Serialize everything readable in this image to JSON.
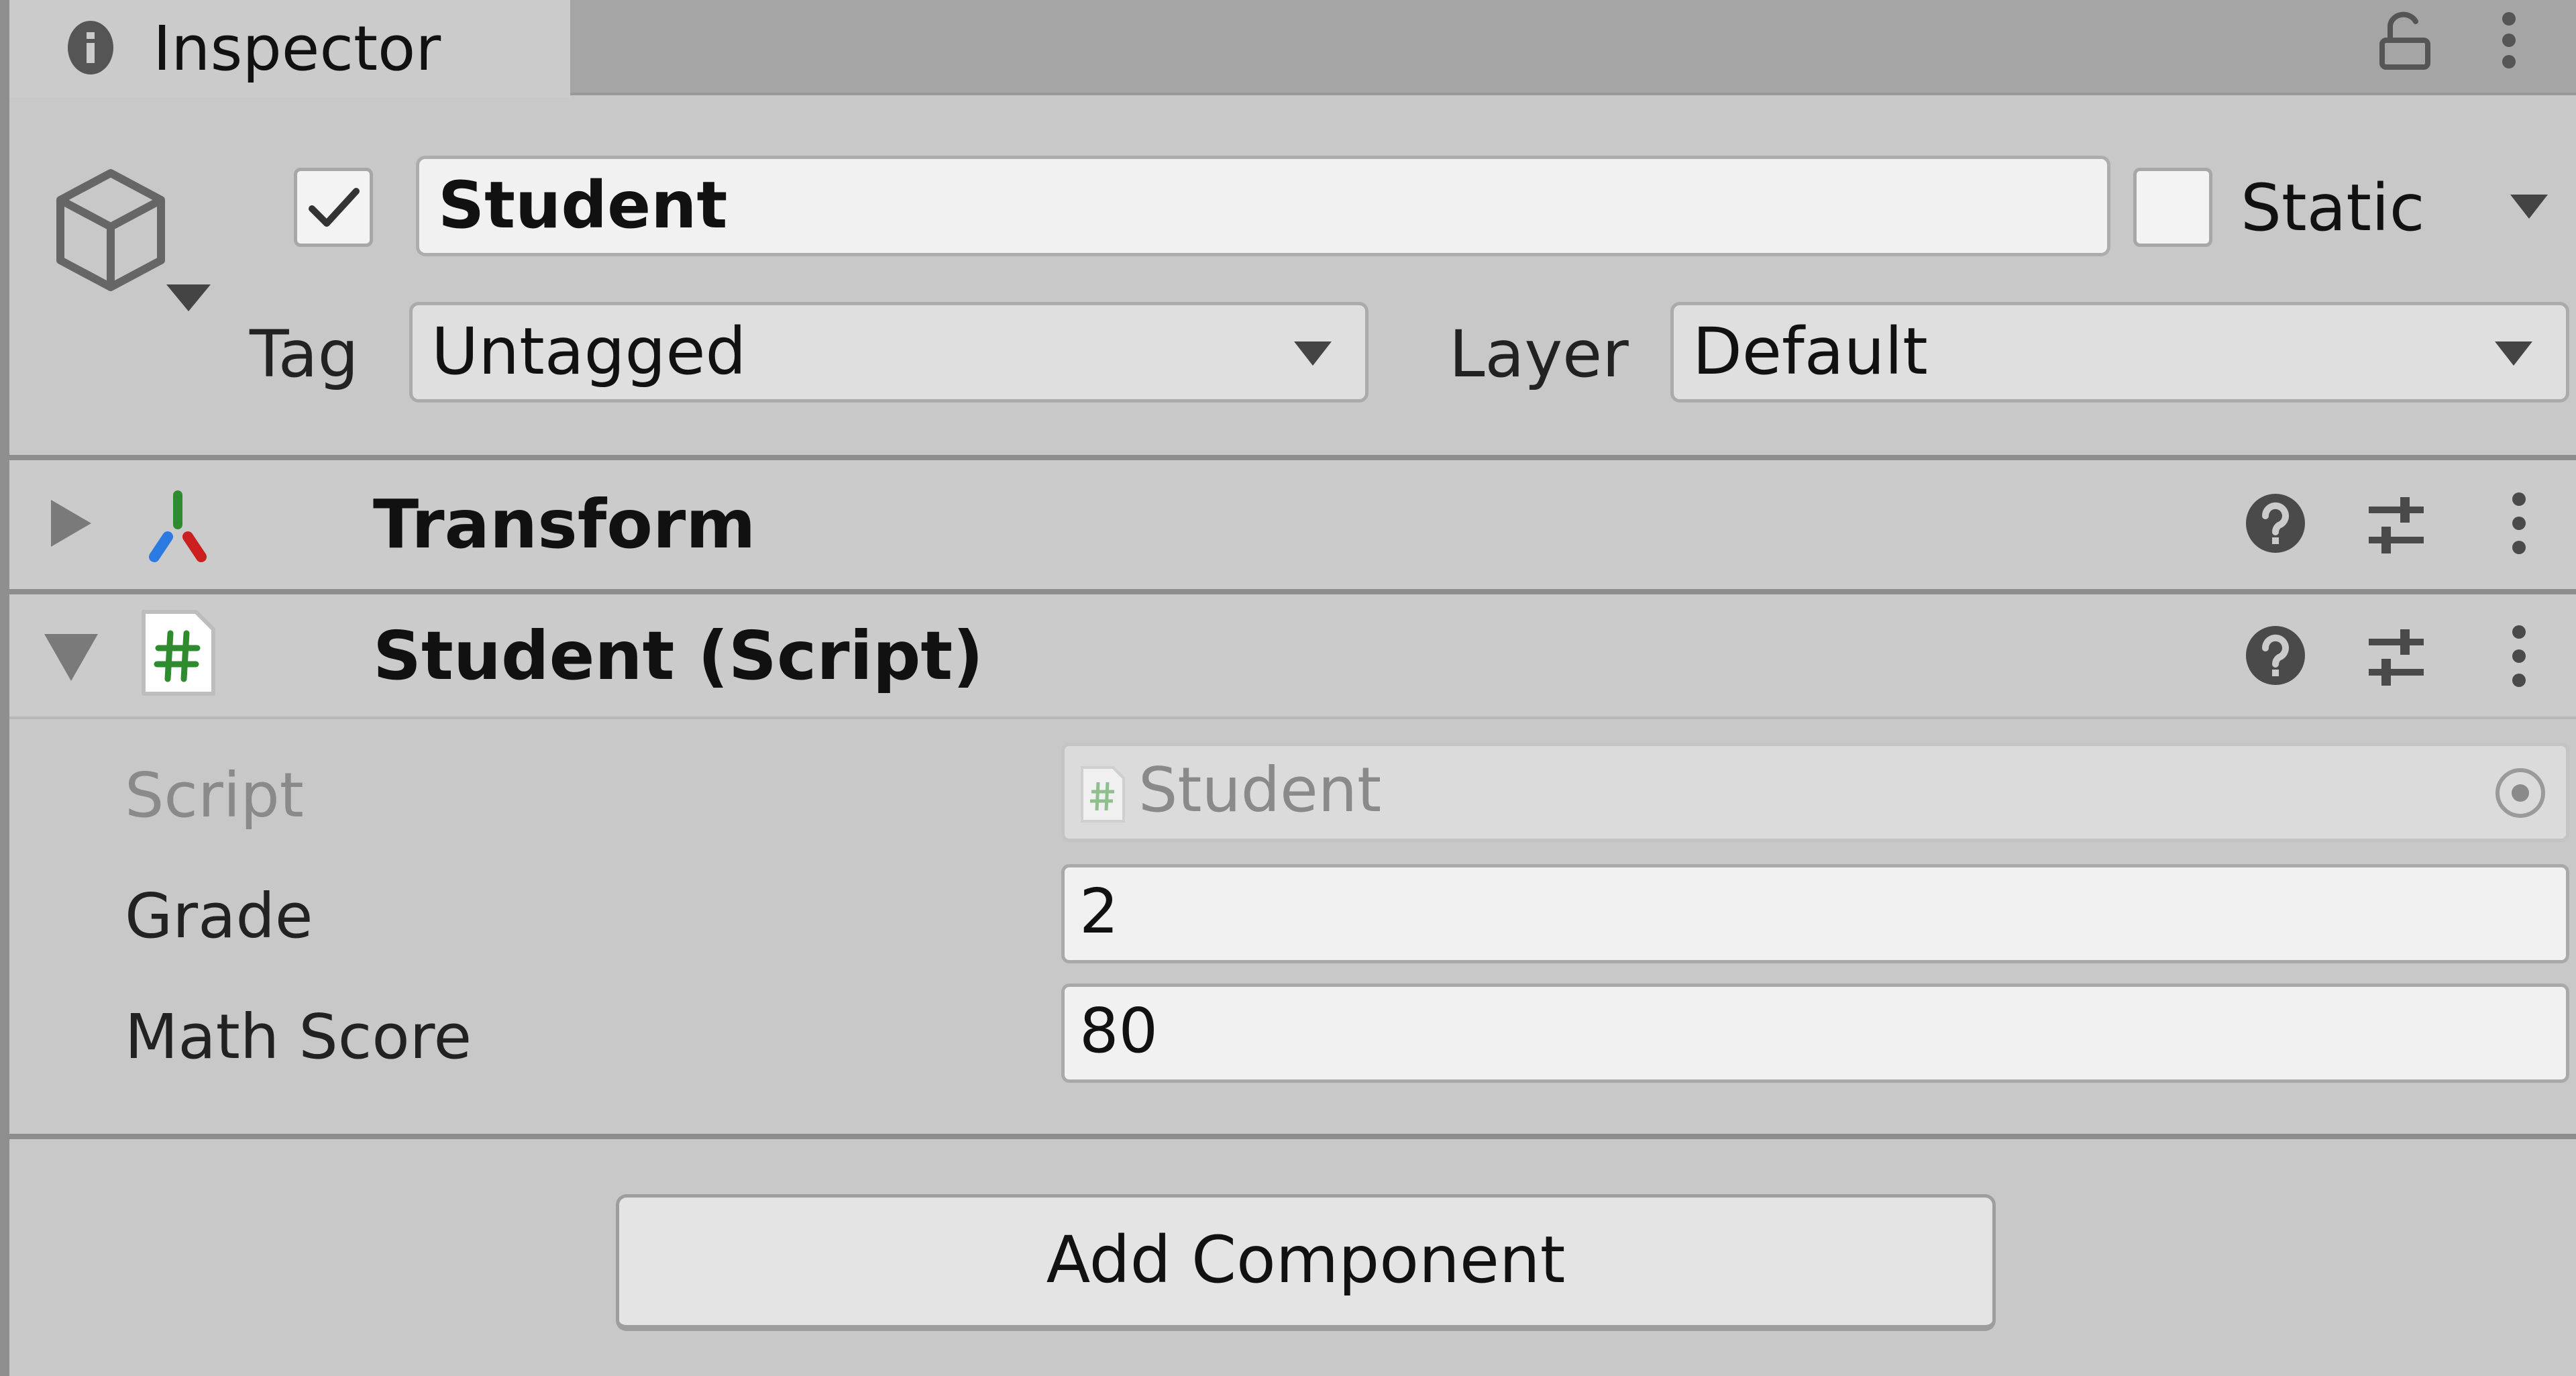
{
  "window": {
    "tab": {
      "label": "Inspector",
      "icon": "info-icon"
    },
    "toolbar_icons": [
      "lock-open-icon",
      "kebab-menu-icon"
    ]
  },
  "game_object": {
    "icon": "cube-icon",
    "active": true,
    "name": "Student",
    "static_label": "Static",
    "static": false,
    "tag_label": "Tag",
    "tag_value": "Untagged",
    "layer_label": "Layer",
    "layer_value": "Default"
  },
  "components": [
    {
      "title": "Transform",
      "expanded": false,
      "icon": "transform-axes-icon"
    },
    {
      "title": "Student (Script)",
      "expanded": true,
      "icon": "csharp-script-icon",
      "properties": [
        {
          "label": "Script",
          "value": "Student",
          "readonly": true
        },
        {
          "label": "Grade",
          "value": "2",
          "readonly": false
        },
        {
          "label": "Math Score",
          "value": "80",
          "readonly": false
        }
      ]
    }
  ],
  "header_icons": [
    "help-icon",
    "preset-sliders-icon",
    "kebab-menu-icon"
  ],
  "colors": {
    "panel_bg": "#c8c8c8",
    "tab_bar_bg": "#a5a5a5",
    "axis_x": "#cc1f1f",
    "axis_y": "#2e8b2e",
    "axis_z": "#2a7ae2",
    "script_hash": "#2e8b2e"
  },
  "add_component_label": "Add Component"
}
